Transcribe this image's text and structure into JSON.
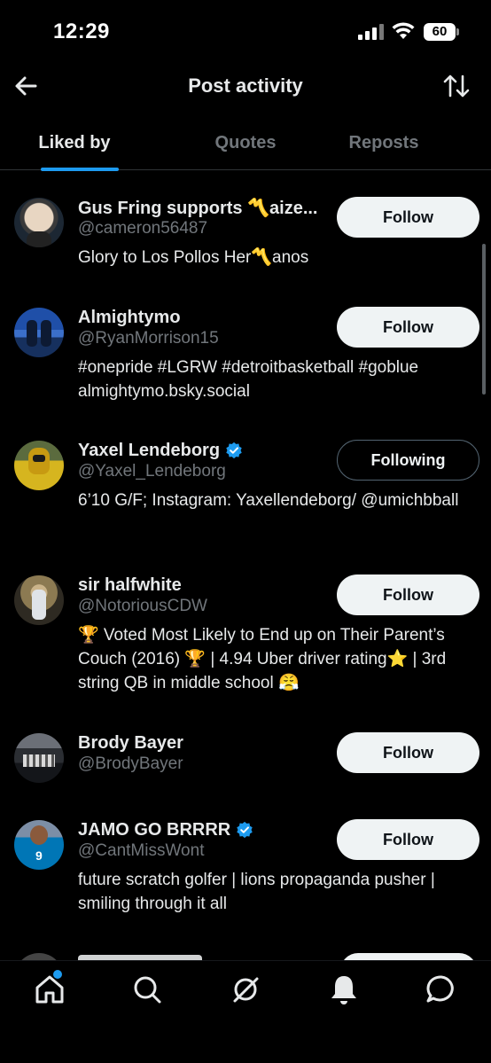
{
  "status_bar": {
    "time": "12:29",
    "battery": "60"
  },
  "header": {
    "title": "Post activity"
  },
  "tabs": [
    {
      "label": "Liked by",
      "active": true
    },
    {
      "label": "Quotes",
      "active": false
    },
    {
      "label": "Reposts",
      "active": false
    }
  ],
  "users": [
    {
      "name": "Gus Fring supports 〽️aize...",
      "handle": "@cameron56487",
      "bio": "Glory to Los Pollos Her〽️anos",
      "verified": false,
      "button": "Follow"
    },
    {
      "name": "Almightymo",
      "handle": "@RyanMorrison15",
      "bio": "#onepride #LGRW #detroitbasketball #goblue almightymo.bsky.social",
      "verified": false,
      "button": "Follow"
    },
    {
      "name": "Yaxel Lendeborg",
      "handle": "@Yaxel_Lendeborg",
      "bio": "6’10 G/F; Instagram: Yaxellendeborg/ @umichbball",
      "verified": true,
      "button": "Following"
    },
    {
      "name": "sir halfwhite",
      "handle": "@NotoriousCDW",
      "bio": "🏆 Voted Most Likely to End up on Their Parent’s Couch (2016) 🏆 | 4.94 Uber driver rating⭐️ | 3rd string QB in middle school 😤",
      "verified": false,
      "button": "Follow"
    },
    {
      "name": "Brody Bayer",
      "handle": "@BrodyBayer",
      "bio": "",
      "verified": false,
      "button": "Follow"
    },
    {
      "name": "JAMO GO BRRRR",
      "handle": "@CantMissWont",
      "bio": "future scratch golfer | lions propaganda pusher | smiling through it all",
      "verified": true,
      "button": "Follow"
    }
  ],
  "colors": {
    "accent": "#1d9bf0",
    "background": "#000000",
    "secondary_text": "#71767b",
    "button_bg": "#eff3f4"
  },
  "icons": {
    "back": "arrow-left-icon",
    "sort": "sort-arrows-icon",
    "verified": "verified-badge-icon",
    "nav": [
      "home-icon",
      "search-icon",
      "grok-icon",
      "bell-icon",
      "message-icon"
    ]
  }
}
